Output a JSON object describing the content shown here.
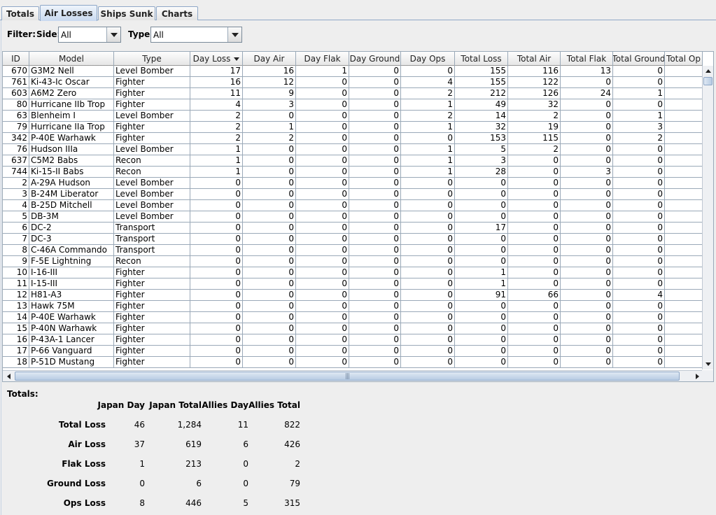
{
  "tabs": [
    {
      "label": "Totals",
      "selected": false
    },
    {
      "label": "Air Losses",
      "selected": true
    },
    {
      "label": "Ships Sunk",
      "selected": false
    },
    {
      "label": "Charts",
      "selected": false
    }
  ],
  "filter": {
    "label": "Filter:",
    "side_label": "Side:",
    "side_value": "All",
    "type_label": "Type:",
    "type_value": "All"
  },
  "table": {
    "columns": [
      "ID",
      "Model",
      "Type",
      "Day Loss",
      "Day Air",
      "Day Flak",
      "Day Ground",
      "Day Ops",
      "Total Loss",
      "Total Air",
      "Total Flak",
      "Total Ground",
      "Total Op"
    ],
    "sorted_column": "Day Loss",
    "rows": [
      [
        "670",
        "G3M2 Nell",
        "Level Bomber",
        "17",
        "16",
        "1",
        "0",
        "0",
        "155",
        "116",
        "13",
        "0"
      ],
      [
        "761",
        "Ki-43-Ic Oscar",
        "Fighter",
        "16",
        "12",
        "0",
        "0",
        "4",
        "155",
        "122",
        "0",
        "0"
      ],
      [
        "603",
        "A6M2 Zero",
        "Fighter",
        "11",
        "9",
        "0",
        "0",
        "2",
        "212",
        "126",
        "24",
        "1"
      ],
      [
        "80",
        "Hurricane IIb Trop",
        "Fighter",
        "4",
        "3",
        "0",
        "0",
        "1",
        "49",
        "32",
        "0",
        "0"
      ],
      [
        "63",
        "Blenheim I",
        "Level Bomber",
        "2",
        "0",
        "0",
        "0",
        "2",
        "14",
        "2",
        "0",
        "1"
      ],
      [
        "79",
        "Hurricane IIa Trop",
        "Fighter",
        "2",
        "1",
        "0",
        "0",
        "1",
        "32",
        "19",
        "0",
        "3"
      ],
      [
        "342",
        "P-40E Warhawk",
        "Fighter",
        "2",
        "2",
        "0",
        "0",
        "0",
        "153",
        "115",
        "0",
        "2"
      ],
      [
        "76",
        "Hudson IIIa",
        "Level Bomber",
        "1",
        "0",
        "0",
        "0",
        "1",
        "5",
        "2",
        "0",
        "0"
      ],
      [
        "637",
        "C5M2 Babs",
        "Recon",
        "1",
        "0",
        "0",
        "0",
        "1",
        "3",
        "0",
        "0",
        "0"
      ],
      [
        "744",
        "Ki-15-II Babs",
        "Recon",
        "1",
        "0",
        "0",
        "0",
        "1",
        "28",
        "0",
        "3",
        "0"
      ],
      [
        "2",
        "A-29A Hudson",
        "Level Bomber",
        "0",
        "0",
        "0",
        "0",
        "0",
        "0",
        "0",
        "0",
        "0"
      ],
      [
        "3",
        "B-24M Liberator",
        "Level Bomber",
        "0",
        "0",
        "0",
        "0",
        "0",
        "0",
        "0",
        "0",
        "0"
      ],
      [
        "4",
        "B-25D Mitchell",
        "Level Bomber",
        "0",
        "0",
        "0",
        "0",
        "0",
        "0",
        "0",
        "0",
        "0"
      ],
      [
        "5",
        "DB-3M",
        "Level Bomber",
        "0",
        "0",
        "0",
        "0",
        "0",
        "0",
        "0",
        "0",
        "0"
      ],
      [
        "6",
        "DC-2",
        "Transport",
        "0",
        "0",
        "0",
        "0",
        "0",
        "17",
        "0",
        "0",
        "0"
      ],
      [
        "7",
        "DC-3",
        "Transport",
        "0",
        "0",
        "0",
        "0",
        "0",
        "0",
        "0",
        "0",
        "0"
      ],
      [
        "8",
        "C-46A Commando",
        "Transport",
        "0",
        "0",
        "0",
        "0",
        "0",
        "0",
        "0",
        "0",
        "0"
      ],
      [
        "9",
        "F-5E Lightning",
        "Recon",
        "0",
        "0",
        "0",
        "0",
        "0",
        "0",
        "0",
        "0",
        "0"
      ],
      [
        "10",
        "I-16-III",
        "Fighter",
        "0",
        "0",
        "0",
        "0",
        "0",
        "1",
        "0",
        "0",
        "0"
      ],
      [
        "11",
        "I-15-III",
        "Fighter",
        "0",
        "0",
        "0",
        "0",
        "0",
        "1",
        "0",
        "0",
        "0"
      ],
      [
        "12",
        "H81-A3",
        "Fighter",
        "0",
        "0",
        "0",
        "0",
        "0",
        "91",
        "66",
        "0",
        "4"
      ],
      [
        "13",
        "Hawk 75M",
        "Fighter",
        "0",
        "0",
        "0",
        "0",
        "0",
        "0",
        "0",
        "0",
        "0"
      ],
      [
        "14",
        "P-40E Warhawk",
        "Fighter",
        "0",
        "0",
        "0",
        "0",
        "0",
        "0",
        "0",
        "0",
        "0"
      ],
      [
        "15",
        "P-40N Warhawk",
        "Fighter",
        "0",
        "0",
        "0",
        "0",
        "0",
        "0",
        "0",
        "0",
        "0"
      ],
      [
        "16",
        "P-43A-1 Lancer",
        "Fighter",
        "0",
        "0",
        "0",
        "0",
        "0",
        "0",
        "0",
        "0",
        "0"
      ],
      [
        "17",
        "P-66 Vanguard",
        "Fighter",
        "0",
        "0",
        "0",
        "0",
        "0",
        "0",
        "0",
        "0",
        "0"
      ],
      [
        "18",
        "P-51D Mustang",
        "Fighter",
        "0",
        "0",
        "0",
        "0",
        "0",
        "0",
        "0",
        "0",
        "0"
      ]
    ]
  },
  "totals": {
    "title": "Totals:",
    "headers": [
      "Japan Day",
      "Japan Total",
      "Allies Day",
      "Allies Total"
    ],
    "rows": [
      {
        "label": "Total Loss",
        "values": [
          "46",
          "1,284",
          "11",
          "822"
        ]
      },
      {
        "label": "Air Loss",
        "values": [
          "37",
          "619",
          "6",
          "426"
        ]
      },
      {
        "label": "Flak Loss",
        "values": [
          "1",
          "213",
          "0",
          "2"
        ]
      },
      {
        "label": "Ground Loss",
        "values": [
          "0",
          "6",
          "0",
          "79"
        ]
      },
      {
        "label": "Ops Loss",
        "values": [
          "8",
          "446",
          "5",
          "315"
        ]
      }
    ]
  }
}
